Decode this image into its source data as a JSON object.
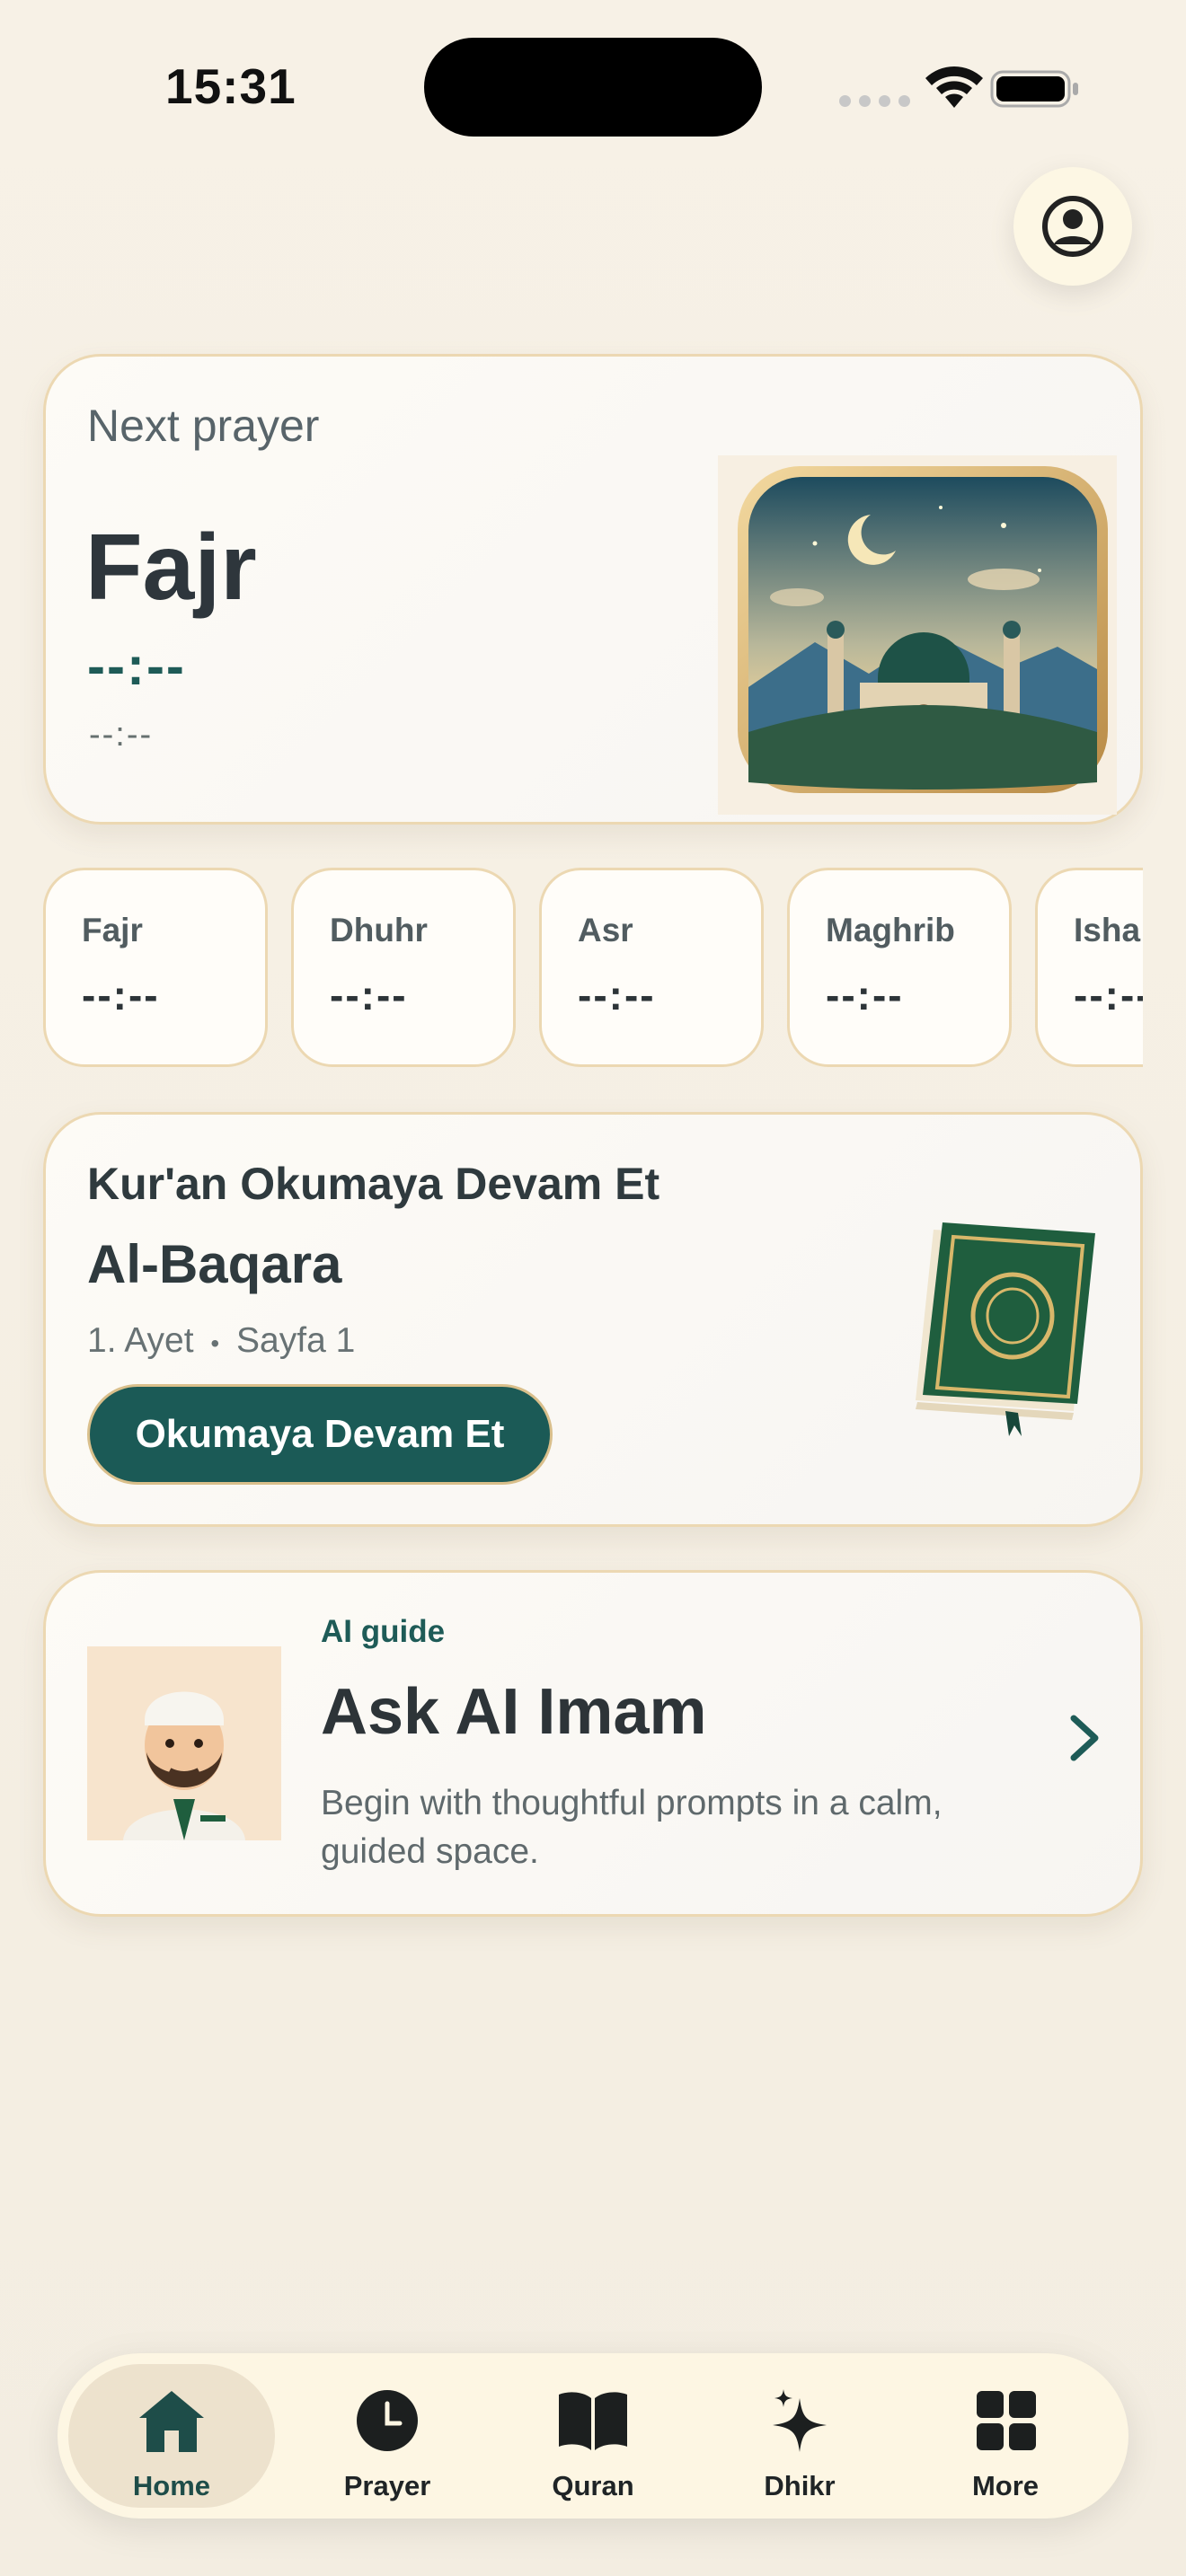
{
  "status_bar": {
    "time": "15:31"
  },
  "next_prayer": {
    "label": "Next prayer",
    "name": "Fajr",
    "time": "--:--",
    "subtime": "--:--"
  },
  "prayers": [
    {
      "name": "Fajr",
      "time": "--:--"
    },
    {
      "name": "Dhuhr",
      "time": "--:--"
    },
    {
      "name": "Asr",
      "time": "--:--"
    },
    {
      "name": "Maghrib",
      "time": "--:--"
    },
    {
      "name": "Isha",
      "time": "--:--"
    }
  ],
  "quran": {
    "title": "Kur'an Okumaya Devam Et",
    "surah": "Al-Baqara",
    "ayah": "1. Ayet",
    "separator": "•",
    "page": "Sayfa 1",
    "button": "Okumaya Devam Et"
  },
  "ai": {
    "tag": "AI guide",
    "title": "Ask AI Imam",
    "description": "Begin with thoughtful prompts in a calm, guided space."
  },
  "tabs": [
    {
      "label": "Home",
      "icon": "home-icon",
      "active": true
    },
    {
      "label": "Prayer",
      "icon": "clock-icon",
      "active": false
    },
    {
      "label": "Quran",
      "icon": "book-icon",
      "active": false
    },
    {
      "label": "Dhikr",
      "icon": "sparkle-icon",
      "active": false
    },
    {
      "label": "More",
      "icon": "grid-icon",
      "active": false
    }
  ],
  "colors": {
    "accent": "#1b5a56",
    "card_border": "#ecd8b2",
    "background": "#f6f0e5"
  }
}
